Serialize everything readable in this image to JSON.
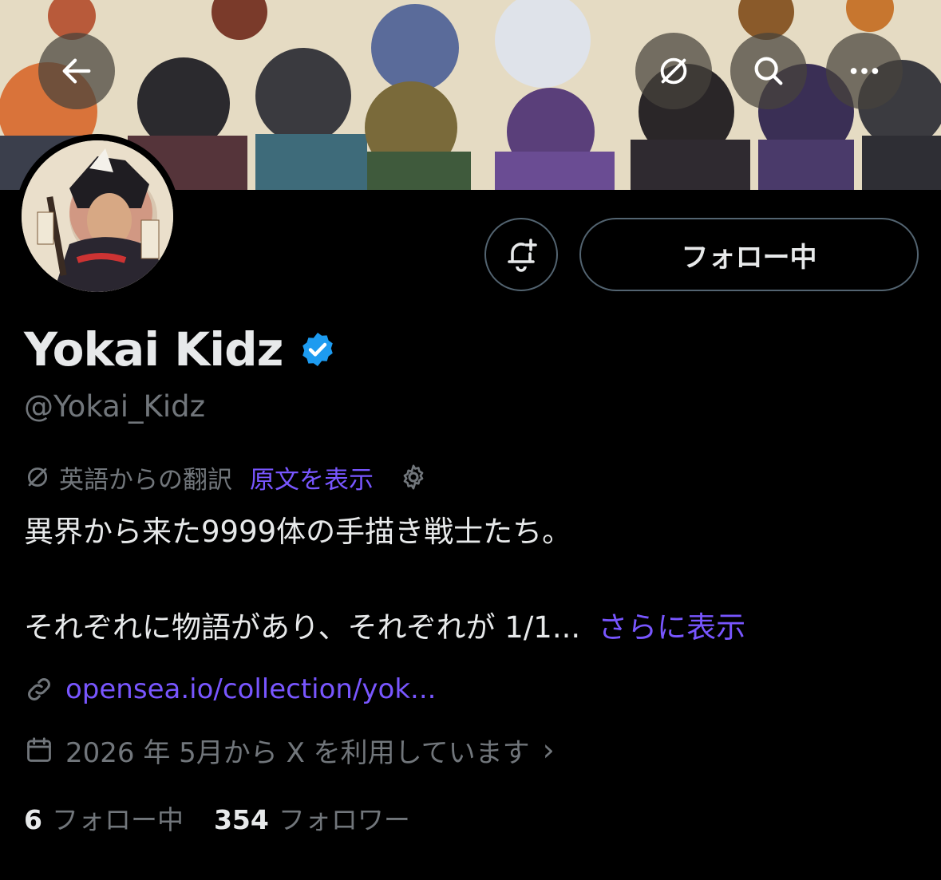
{
  "header": {
    "back_icon": "arrow-left-icon",
    "grok_icon": "grok-icon",
    "search_icon": "search-icon",
    "more_icon": "more-dots-icon"
  },
  "banner": {
    "description_colors": [
      "#e5dbc3",
      "#2f3a4a",
      "#6a4c93",
      "#c8462f"
    ]
  },
  "profile": {
    "display_name": "Yokai Kidz",
    "verified": true,
    "handle": "@Yokai_Kidz",
    "notification_icon": "bell-plus-icon",
    "follow_button_label": "フォロー中"
  },
  "translation": {
    "label": "英語からの翻訳",
    "show_original": "原文を表示"
  },
  "bio": {
    "line1": "異界から来た9999体の手描き戦士たち。",
    "line2": "それぞれに物語があり、それぞれが 1/1...",
    "more_label": "さらに表示"
  },
  "link": {
    "url_text": "opensea.io/collection/yok..."
  },
  "joined": {
    "text": "2026 年 5月から X を利用しています",
    "chevron": "›"
  },
  "stats": {
    "following_count": "6",
    "following_label": "フォロー中",
    "followers_count": "354",
    "followers_label": "フォロワー"
  },
  "colors": {
    "background": "#000000",
    "text_primary": "#e7e9ea",
    "text_secondary": "#71767b",
    "accent_link": "#7856ff",
    "verified_badge": "#1d9bf0",
    "button_border": "#536471"
  }
}
